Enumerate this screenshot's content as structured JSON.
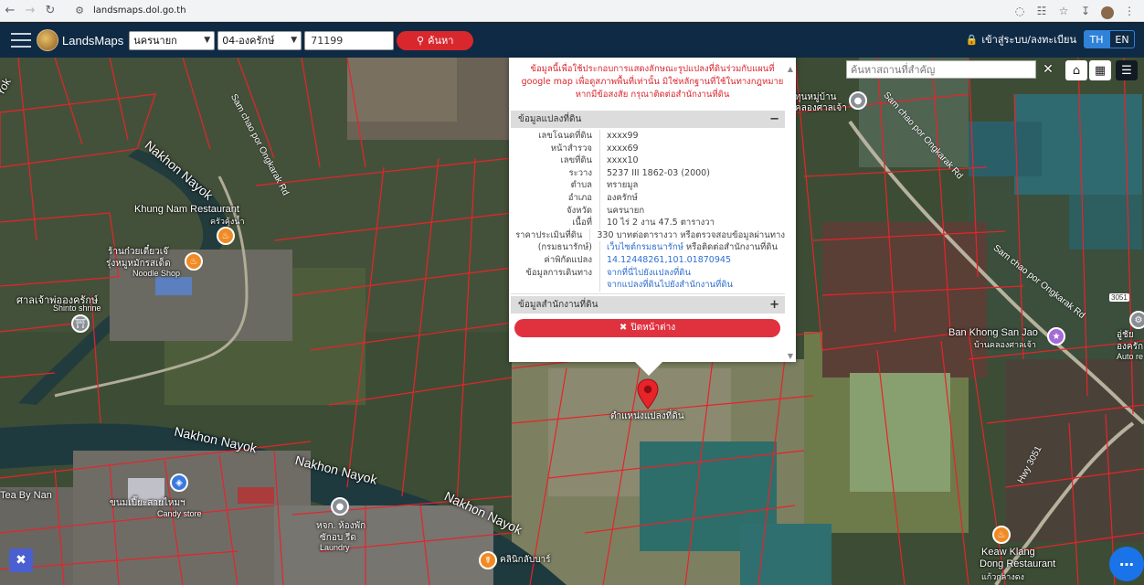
{
  "browser": {
    "url": "landsmaps.dol.go.th"
  },
  "navbar": {
    "brand": "LandsMaps",
    "province": "นครนายก",
    "district": "04-องครักษ์",
    "parcel_number": "71199",
    "search_label": "ค้นหา",
    "login_label": "เข้าสู่ระบบ/ลงทะเบียน",
    "lang_th": "TH",
    "lang_en": "EN"
  },
  "map_search": {
    "placeholder": "ค้นหาสถานที่สำคัญ"
  },
  "popup": {
    "notice": "ข้อมูลนี้เพื่อใช้ประกอบการแสดงลักษณะรูปแปลงที่ดินร่วมกับแผนที่ google map เพื่อดูสภาพพื้นที่เท่านั้น มิใช่หลักฐานที่ใช้ในทางกฎหมาย หากมีข้อสงสัย กรุณาติดต่อสำนักงานที่ดิน",
    "section_land": "ข้อมูลแปลงที่ดิน",
    "section_office": "ข้อมูลสำนักงานที่ดิน",
    "rows": [
      {
        "label": "เลขโฉนดที่ดิน",
        "value": "xxxx99"
      },
      {
        "label": "หน้าสำรวจ",
        "value": "xxxx69"
      },
      {
        "label": "เลขที่ดิน",
        "value": "xxxx10"
      },
      {
        "label": "ระวาง",
        "value": "5237 III 1862-03 (2000)"
      },
      {
        "label": "ตำบล",
        "value": "ทรายมูล"
      },
      {
        "label": "อำเภอ",
        "value": "องครักษ์"
      },
      {
        "label": "จังหวัด",
        "value": "นครนายก"
      },
      {
        "label": "เนื้อที่",
        "value": "10 ไร่ 2 งาน 47.5 ตารางวา"
      },
      {
        "label": "ราคาประเมินที่ดิน",
        "value": "330 บาทต่อตารางวา หรือตรวจสอบข้อมูลผ่านทาง"
      },
      {
        "label": "(กรมธนารักษ์)",
        "value": "เว็บไซต์กรมธนารักษ์ หรือติดต่อสำนักงานที่ดิน"
      },
      {
        "label": "ค่าพิกัดแปลง",
        "value": "14.12448261,101.01870945"
      },
      {
        "label": "ข้อมูลการเดินทาง",
        "value": "จากที่นี่ไปยังแปลงที่ดิน"
      },
      {
        "label": "",
        "value": "จากแปลงที่ดินไปยังสำนักงานที่ดิน"
      }
    ],
    "close_label": "ปิดหน้าต่าง"
  },
  "map_labels": {
    "marker_label": "ตำแหน่งแปลงที่ดิน",
    "river_1": "Nakhon Nayok",
    "river_2": "Nakhon Nayok",
    "river_3": "Nakhon Nayok",
    "river_4": "Nakhon Nayok",
    "road_1": "Sam chao por Ongkarak Rd",
    "road_2": "Sam chao por Ongkarak Rd",
    "road_3": "Sam chao por Ongkarak Rd",
    "road_4": "Sam chao por Ongkarak Rd",
    "hwy": "Hwy 3051",
    "shield": "3051",
    "khung_nam": "Khung Nam Restaurant",
    "khung_nam_th": "ครัวคุ้งน้ำ",
    "noodle_th1": "ร้านก๋วยเตี๋ยวเจ๊",
    "noodle_th2": "รุ่งหมูหมักรสเด็ด",
    "noodle_en": "Noodle Shop",
    "shrine_th": "ศาลเจ้าพ่อองครักษ์",
    "shrine_en": "Shinto shrine",
    "tea": "Tea By Nan",
    "candy_th": "ขนมเปี๊ยะสายไหมฯ",
    "candy_en": "Candy store",
    "laundry_th1": "หจก. ห้องพัก",
    "laundry_th2": "ซักอบ รีด",
    "laundry_en": "Laundry",
    "clinic": "คลินิกลับบาร์",
    "ban_khong": "Ban Khong San Jao",
    "ban_khong_th": "บ้านคลองศาลเจ้า",
    "temple_th1": "ทุนหมู่บ้าน",
    "temple_th2": "คลองศาลเจ้า",
    "auto_th1": "อู่ชัย",
    "auto_th2": "องครัก",
    "auto_en": "Auto re",
    "keaw": "Keaw Klang",
    "keaw2": "Dong Restaurant",
    "keaw_th": "แก้วกลางดง"
  },
  "colors": {
    "navbar": "#0f2a44",
    "accent_red": "#d9272e",
    "lang_active": "#2f82d8",
    "parcel_line": "#e8232a"
  }
}
